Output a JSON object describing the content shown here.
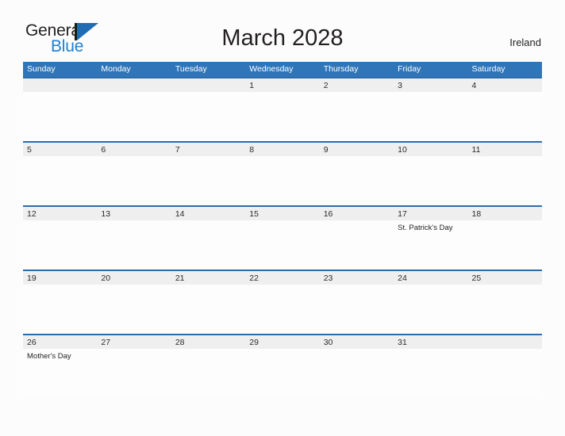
{
  "brand": {
    "name_part1": "General",
    "name_part2": "Blue",
    "logo_icon": "general-blue-triangle-logo",
    "color_blue": "#1f7fd0",
    "color_dark": "#231f20"
  },
  "header": {
    "title": "March 2028",
    "country": "Ireland"
  },
  "theme": {
    "header_row_bg": "#3075b8",
    "date_band_bg": "#efefef",
    "date_band_border": "#2d6ca8",
    "page_bg": "#fcfcfc",
    "cell_bg": "#fdfdfd"
  },
  "calendar": {
    "weekdays": [
      "Sunday",
      "Monday",
      "Tuesday",
      "Wednesday",
      "Thursday",
      "Friday",
      "Saturday"
    ],
    "weeks": [
      [
        {
          "day": "",
          "event": ""
        },
        {
          "day": "",
          "event": ""
        },
        {
          "day": "",
          "event": ""
        },
        {
          "day": "1",
          "event": ""
        },
        {
          "day": "2",
          "event": ""
        },
        {
          "day": "3",
          "event": ""
        },
        {
          "day": "4",
          "event": ""
        }
      ],
      [
        {
          "day": "5",
          "event": ""
        },
        {
          "day": "6",
          "event": ""
        },
        {
          "day": "7",
          "event": ""
        },
        {
          "day": "8",
          "event": ""
        },
        {
          "day": "9",
          "event": ""
        },
        {
          "day": "10",
          "event": ""
        },
        {
          "day": "11",
          "event": ""
        }
      ],
      [
        {
          "day": "12",
          "event": ""
        },
        {
          "day": "13",
          "event": ""
        },
        {
          "day": "14",
          "event": ""
        },
        {
          "day": "15",
          "event": ""
        },
        {
          "day": "16",
          "event": ""
        },
        {
          "day": "17",
          "event": "St. Patrick's Day"
        },
        {
          "day": "18",
          "event": ""
        }
      ],
      [
        {
          "day": "19",
          "event": ""
        },
        {
          "day": "20",
          "event": ""
        },
        {
          "day": "21",
          "event": ""
        },
        {
          "day": "22",
          "event": ""
        },
        {
          "day": "23",
          "event": ""
        },
        {
          "day": "24",
          "event": ""
        },
        {
          "day": "25",
          "event": ""
        }
      ],
      [
        {
          "day": "26",
          "event": "Mother's Day"
        },
        {
          "day": "27",
          "event": ""
        },
        {
          "day": "28",
          "event": ""
        },
        {
          "day": "29",
          "event": ""
        },
        {
          "day": "30",
          "event": ""
        },
        {
          "day": "31",
          "event": ""
        },
        {
          "day": "",
          "event": ""
        }
      ]
    ]
  }
}
